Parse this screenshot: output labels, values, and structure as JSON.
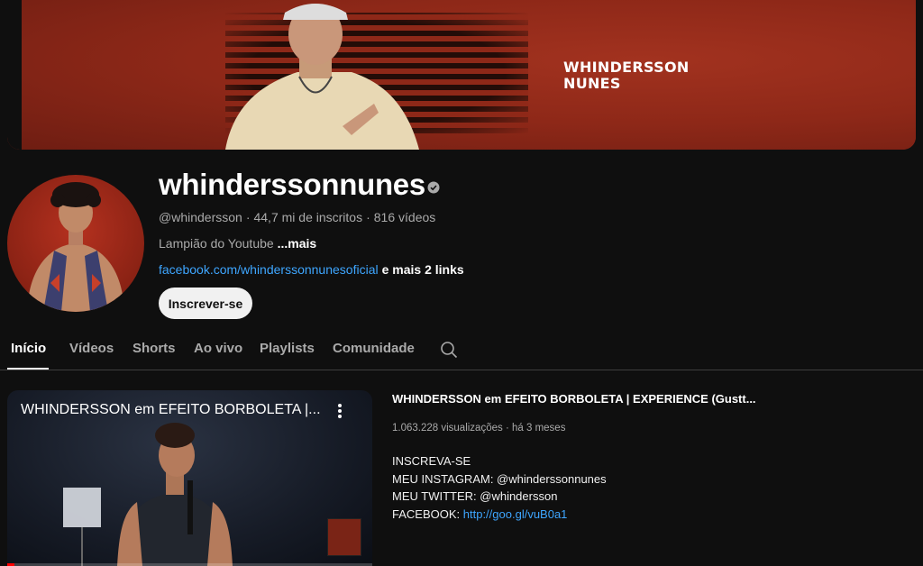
{
  "banner": {
    "title_line1": "WHINDERSSON",
    "title_line2": "NUNES"
  },
  "channel": {
    "name": "whinderssonnunes",
    "handle": "@whindersson",
    "subscribers": "44,7 mi de inscritos",
    "videos": "816 vídeos",
    "meta_separator": "·",
    "description": "Lampião do Youtube",
    "more_label": "...mais",
    "link": "facebook.com/whinderssonnunesoficial",
    "more_links": "e mais 2 links",
    "subscribe_label": "Inscrever-se"
  },
  "tabs": [
    {
      "label": "Início",
      "active": true
    },
    {
      "label": "Vídeos",
      "active": false
    },
    {
      "label": "Shorts",
      "active": false
    },
    {
      "label": "Ao vivo",
      "active": false
    },
    {
      "label": "Playlists",
      "active": false
    },
    {
      "label": "Comunidade",
      "active": false
    }
  ],
  "featured": {
    "thumb_title": "WHINDERSSON em EFEITO BORBOLETA |...",
    "title": "WHINDERSSON em EFEITO BORBOLETA | EXPERIENCE (Gustt...",
    "views": "1.063.228 visualizações",
    "meta_separator": "·",
    "age": "há 3 meses",
    "desc_lines": [
      "INSCREVA-SE",
      "MEU INSTAGRAM: @whinderssonnunes",
      "MEU TWITTER: @whindersson"
    ],
    "facebook_label": "FACEBOOK:",
    "facebook_url": "http://goo.gl/vuB0a1",
    "progress": 0.02
  },
  "colors": {
    "accent_link": "#3ea6ff",
    "background": "#0f0f0f",
    "banner": "#8e2818"
  }
}
